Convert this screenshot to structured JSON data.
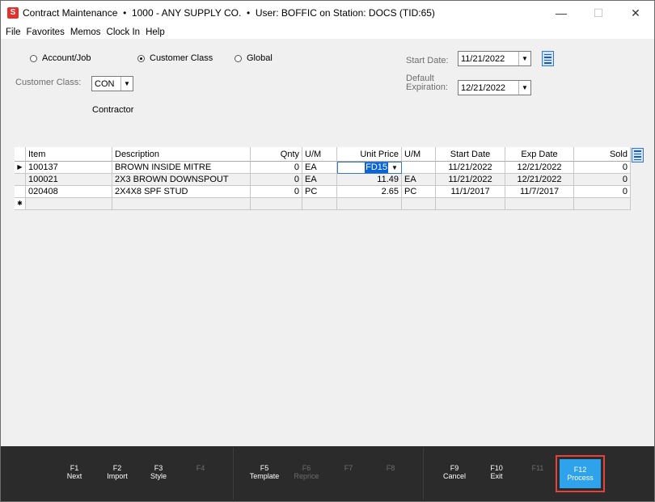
{
  "window": {
    "title": "Contract Maintenance  •  1000 - ANY SUPPLY CO.  •  User: BOFFIC on Station: DOCS (TID:65)",
    "app_icon_letter": "S",
    "minimize": "—",
    "maximize": "☐",
    "close": "✕"
  },
  "menu": [
    "File",
    "Favorites",
    "Memos",
    "Clock In",
    "Help"
  ],
  "form": {
    "radios": {
      "account_job": "Account/Job",
      "customer_class": "Customer Class",
      "global": "Global",
      "selected": "customer_class"
    },
    "customer_class_label": "Customer Class:",
    "customer_class_value": "CON",
    "customer_class_desc": "Contractor",
    "start_date_label": "Start Date:",
    "start_date_value": "11/21/2022",
    "default_expiration_label_1": "Default",
    "default_expiration_label_2": "Expiration:",
    "default_expiration_value": "12/21/2022"
  },
  "grid": {
    "columns": {
      "item": "Item",
      "description": "Description",
      "qnty": "Qnty",
      "um": "U/M",
      "unit_price": "Unit Price",
      "um2": "U/M",
      "start_date": "Start Date",
      "exp_date": "Exp Date",
      "sold": "Sold"
    },
    "rows": [
      {
        "marker": "▶",
        "item": "100137",
        "description": "BROWN INSIDE MITRE",
        "qnty": "0",
        "um": "EA",
        "unit_price": "FD15",
        "um2": "",
        "start_date": "11/21/2022",
        "exp_date": "12/21/2022",
        "sold": "0"
      },
      {
        "marker": "",
        "item": "100021",
        "description": "2X3 BROWN DOWNSPOUT",
        "qnty": "0",
        "um": "EA",
        "unit_price": "11.49",
        "um2": "EA",
        "start_date": "11/21/2022",
        "exp_date": "12/21/2022",
        "sold": "0"
      },
      {
        "marker": "",
        "item": "020408",
        "description": "2X4X8 SPF STUD",
        "qnty": "0",
        "um": "PC",
        "unit_price": "2.65",
        "um2": "PC",
        "start_date": "11/1/2017",
        "exp_date": "11/7/2017",
        "sold": "0"
      }
    ],
    "new_row_marker": "✱"
  },
  "fkeys": [
    {
      "key": "F1",
      "label": "Next",
      "enabled": true
    },
    {
      "key": "F2",
      "label": "Import",
      "enabled": true
    },
    {
      "key": "F3",
      "label": "Style",
      "enabled": true
    },
    {
      "key": "F4",
      "label": "",
      "enabled": false
    },
    {
      "key": "F5",
      "label": "Template",
      "enabled": true
    },
    {
      "key": "F6",
      "label": "Reprice",
      "enabled": false
    },
    {
      "key": "F7",
      "label": "",
      "enabled": false
    },
    {
      "key": "F8",
      "label": "",
      "enabled": false
    },
    {
      "key": "F9",
      "label": "Cancel",
      "enabled": true
    },
    {
      "key": "F10",
      "label": "Exit",
      "enabled": true
    },
    {
      "key": "F11",
      "label": "",
      "enabled": false
    },
    {
      "key": "F12",
      "label": "Process",
      "enabled": true
    }
  ],
  "colors": {
    "accent": "#2ea2ea",
    "highlight_border": "#e5423b",
    "fkey_bar": "#2b2b2b",
    "selection": "#0a64d6"
  }
}
